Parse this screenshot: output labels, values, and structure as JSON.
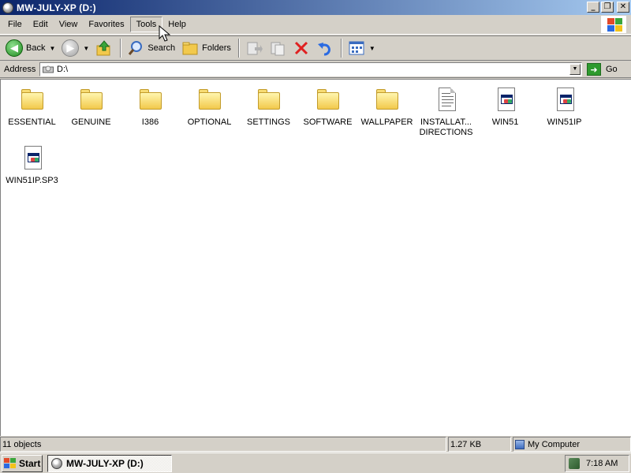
{
  "window": {
    "title": "MW-JULY-XP (D:)"
  },
  "menu": {
    "items": [
      "File",
      "Edit",
      "View",
      "Favorites",
      "Tools",
      "Help"
    ],
    "active": "Tools"
  },
  "toolbar": {
    "back_label": "Back",
    "search_label": "Search",
    "folders_label": "Folders"
  },
  "address": {
    "label": "Address",
    "value": "D:\\",
    "go_label": "Go"
  },
  "files": [
    {
      "name": "ESSENTIAL",
      "type": "folder"
    },
    {
      "name": "GENUINE",
      "type": "folder"
    },
    {
      "name": "I386",
      "type": "folder"
    },
    {
      "name": "OPTIONAL",
      "type": "folder"
    },
    {
      "name": "SETTINGS",
      "type": "folder"
    },
    {
      "name": "SOFTWARE",
      "type": "folder"
    },
    {
      "name": "WALLPAPER",
      "type": "folder"
    },
    {
      "name": "INSTALLAT... DIRECTIONS",
      "type": "document"
    },
    {
      "name": "WIN51",
      "type": "system-file"
    },
    {
      "name": "WIN51IP",
      "type": "system-file"
    },
    {
      "name": "WIN51IP.SP3",
      "type": "system-file"
    }
  ],
  "status": {
    "objects": "11 objects",
    "size": "1.27 KB",
    "zone": "My Computer"
  },
  "taskbar": {
    "start_label": "Start",
    "task_label": "MW-JULY-XP (D:)",
    "clock": "7:18 AM"
  }
}
